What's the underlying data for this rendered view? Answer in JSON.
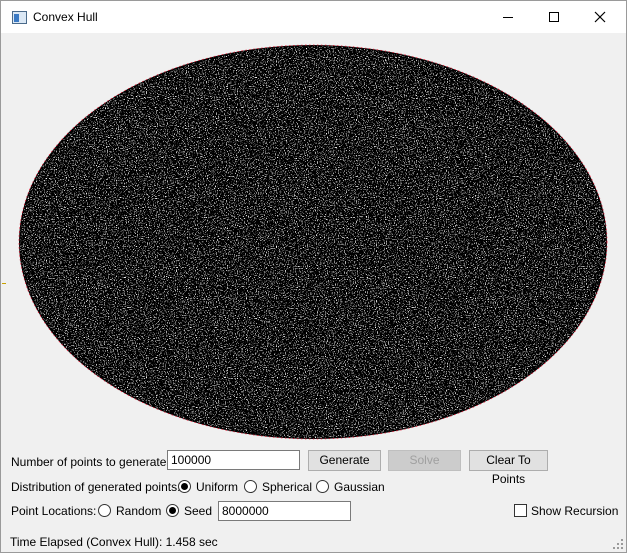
{
  "window": {
    "title": "Convex Hull",
    "icon": "app-window-icon",
    "controls": [
      "minimize-icon",
      "maximize-icon",
      "close-icon"
    ]
  },
  "controls": {
    "num_points_label": "Number of points to generate:",
    "num_points_value": "100000",
    "generate_label": "Generate",
    "solve_label": "Solve",
    "clear_label": "Clear To Points",
    "distribution_label": "Distribution of generated points:",
    "distributions": [
      {
        "label": "Uniform",
        "checked": true
      },
      {
        "label": "Spherical",
        "checked": false
      },
      {
        "label": "Gaussian",
        "checked": false
      }
    ],
    "location_label": "Point Locations:",
    "locations": [
      {
        "label": "Random",
        "checked": false
      },
      {
        "label": "Seed",
        "checked": true
      }
    ],
    "seed_value": "8000000",
    "show_recursion_label": "Show Recursion",
    "show_recursion_checked": false
  },
  "status": {
    "text": "Time Elapsed (Convex Hull): 1.458 sec"
  },
  "colors": {
    "points_fill": "#000000",
    "points_speckle": "#ffffff",
    "hull_outline": "#e0203a",
    "canvas_bg": "#f0f0f0"
  }
}
